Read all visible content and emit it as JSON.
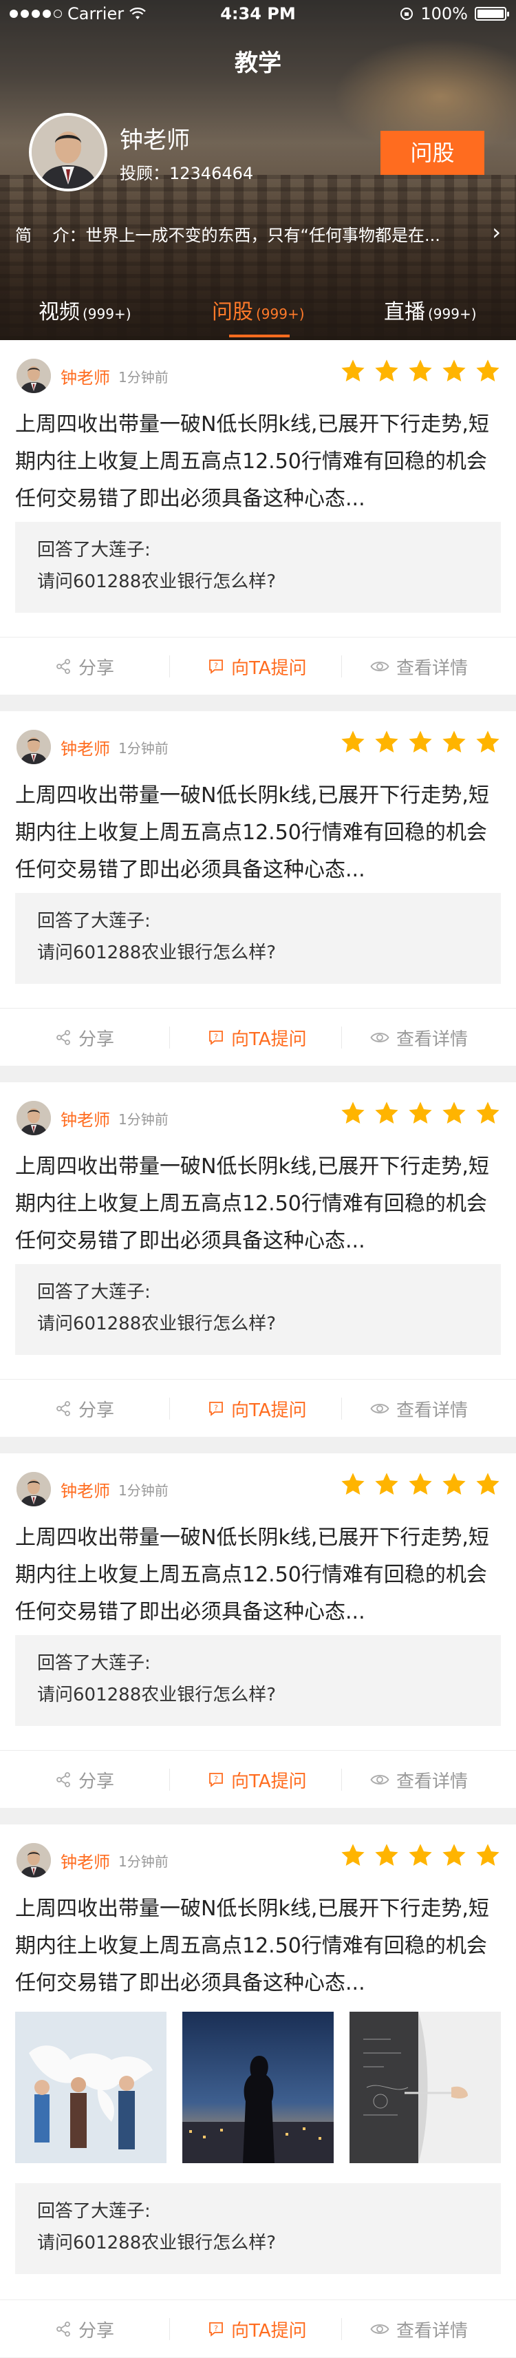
{
  "status_bar": {
    "carrier": "Carrier",
    "time": "4:34 PM",
    "battery": "100%"
  },
  "nav": {
    "title": "教学"
  },
  "teacher": {
    "name": "钟老师",
    "advisor_no": "投顾：12346464",
    "ask_button": "问股",
    "intro_label": "简    介：",
    "intro_text": "世界上一成不变的东西，只有“任何事物都是在..."
  },
  "tabs": [
    {
      "label": "视频",
      "count": "(999+)"
    },
    {
      "label": "问股",
      "count": "(999+)"
    },
    {
      "label": "直播",
      "count": "(999+)"
    }
  ],
  "active_tab_index": 1,
  "posts": [
    {
      "author": "钟老师",
      "time": "1分钟前",
      "rating": 5,
      "body": "上周四收出带量一破N低长阴k线,已展开下行走势,短期内往上收复上周五高点12.50行情难有回稳的机会任何交易错了即出必须具备这种心态...",
      "quote_label": "回答了大莲子:",
      "quote_text": "请问601288农业银行怎么样?",
      "actions": {
        "share": "分享",
        "ask": "向TA提问",
        "detail": "查看详情"
      }
    },
    {
      "author": "钟老师",
      "time": "1分钟前",
      "rating": 5,
      "body": "上周四收出带量一破N低长阴k线,已展开下行走势,短期内往上收复上周五高点12.50行情难有回稳的机会任何交易错了即出必须具备这种心态...",
      "quote_label": "回答了大莲子:",
      "quote_text": "请问601288农业银行怎么样?",
      "actions": {
        "share": "分享",
        "ask": "向TA提问",
        "detail": "查看详情"
      }
    },
    {
      "author": "钟老师",
      "time": "1分钟前",
      "rating": 5,
      "body": "上周四收出带量一破N低长阴k线,已展开下行走势,短期内往上收复上周五高点12.50行情难有回稳的机会任何交易错了即出必须具备这种心态...",
      "quote_label": "回答了大莲子:",
      "quote_text": "请问601288农业银行怎么样?",
      "actions": {
        "share": "分享",
        "ask": "向TA提问",
        "detail": "查看详情"
      }
    },
    {
      "author": "钟老师",
      "time": "1分钟前",
      "rating": 5,
      "body": "上周四收出带量一破N低长阴k线,已展开下行走势,短期内往上收复上周五高点12.50行情难有回稳的机会任何交易错了即出必须具备这种心态...",
      "quote_label": "回答了大莲子:",
      "quote_text": "请问601288农业银行怎么样?",
      "actions": {
        "share": "分享",
        "ask": "向TA提问",
        "detail": "查看详情"
      }
    },
    {
      "author": "钟老师",
      "time": "1分钟前",
      "rating": 5,
      "body": "上周四收出带量一破N低长阴k线,已展开下行走势,短期内往上收复上周五高点12.50行情难有回稳的机会任何交易错了即出必须具备这种心态...",
      "quote_label": "回答了大莲子:",
      "quote_text": "请问601288农业银行怎么样?",
      "actions": {
        "share": "分享",
        "ask": "向TA提问",
        "detail": "查看详情"
      }
    }
  ],
  "colors": {
    "accent": "#ff6c1f",
    "star": "#ffb400",
    "muted": "#999999"
  }
}
